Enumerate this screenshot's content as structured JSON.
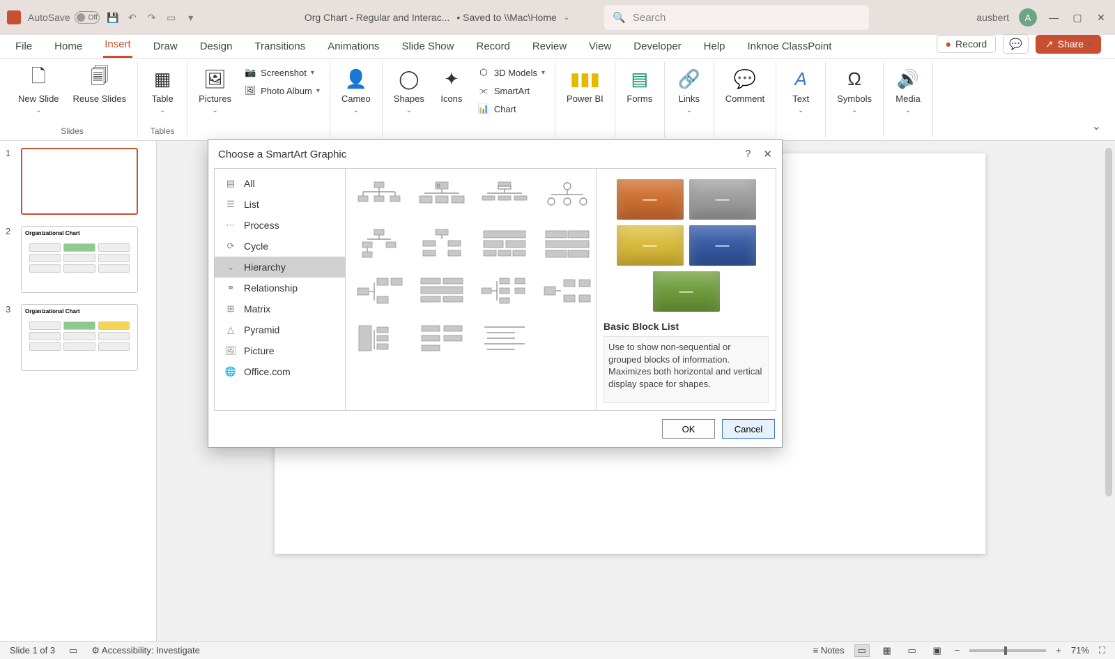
{
  "titlebar": {
    "autosave_label": "AutoSave",
    "autosave_state": "Off",
    "document_title": "Org Chart - Regular and Interac...",
    "save_status": "• Saved to \\\\Mac\\Home",
    "search_placeholder": "Search",
    "username": "ausbert",
    "avatar_initial": "A"
  },
  "tabs": {
    "file": "File",
    "home": "Home",
    "insert": "Insert",
    "draw": "Draw",
    "design": "Design",
    "transitions": "Transitions",
    "animations": "Animations",
    "slideshow": "Slide Show",
    "record_tab": "Record",
    "review": "Review",
    "view": "View",
    "developer": "Developer",
    "help": "Help",
    "classpoint": "Inknoe ClassPoint",
    "record_btn": "Record",
    "share_btn": "Share"
  },
  "ribbon": {
    "new_slide": "New Slide",
    "reuse_slides": "Reuse Slides",
    "table": "Table",
    "pictures": "Pictures",
    "screenshot": "Screenshot",
    "photo_album": "Photo Album",
    "cameo": "Cameo",
    "shapes": "Shapes",
    "icons": "Icons",
    "models3d": "3D Models",
    "smartart": "SmartArt",
    "chart": "Chart",
    "powerbi": "Power BI",
    "forms": "Forms",
    "links": "Links",
    "comment": "Comment",
    "text": "Text",
    "symbols": "Symbols",
    "media": "Media",
    "group_slides": "Slides",
    "group_tables": "Tables"
  },
  "slides": {
    "n1": "1",
    "n2": "2",
    "n3": "3",
    "org_title": "Organizational Chart"
  },
  "dialog": {
    "title": "Choose a SmartArt Graphic",
    "categories": {
      "all": "All",
      "list": "List",
      "process": "Process",
      "cycle": "Cycle",
      "hierarchy": "Hierarchy",
      "relationship": "Relationship",
      "matrix": "Matrix",
      "pyramid": "Pyramid",
      "picture": "Picture",
      "office": "Office.com"
    },
    "preview_title": "Basic Block List",
    "preview_desc": "Use to show non-sequential or grouped blocks of information. Maximizes both horizontal and vertical display space for shapes.",
    "ok": "OK",
    "cancel": "Cancel"
  },
  "statusbar": {
    "slide_info": "Slide 1 of 3",
    "accessibility": "Accessibility: Investigate",
    "notes": "Notes",
    "zoom": "71%"
  }
}
